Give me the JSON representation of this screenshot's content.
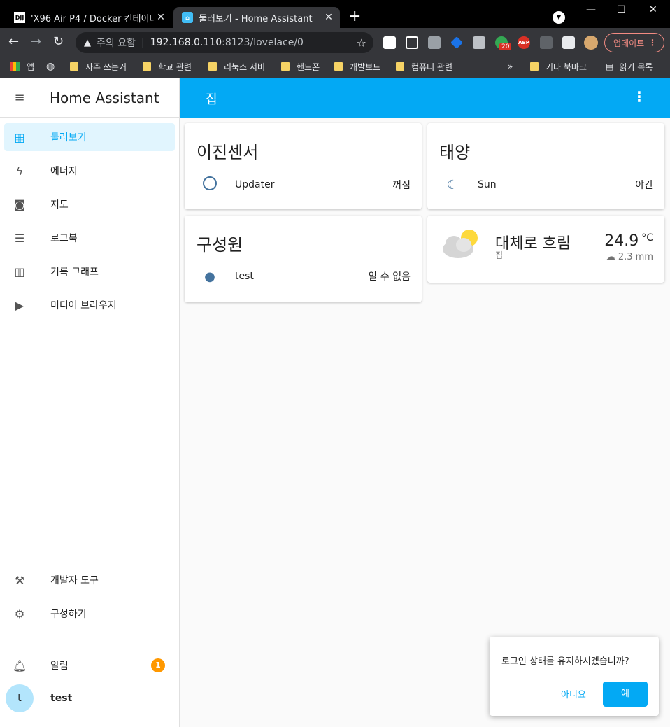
{
  "browser": {
    "tabs": [
      {
        "title": "'X96 Air P4 / Docker 컨테이너 L",
        "favicon_text": "DJJ",
        "active": false
      },
      {
        "title": "둘러보기 - Home Assistant",
        "active": true
      }
    ],
    "url": {
      "warning": "주의 요함",
      "host": "192.168.0.110",
      "path": ":8123/lovelace/0"
    },
    "extension_badge": "20",
    "abp_label": "ABP",
    "update_label": "업데이트",
    "bookmarks": [
      "앱",
      "자주 쓰는거",
      "학교 관련",
      "리눅스 서버",
      "핸드폰",
      "개발보드",
      "컴퓨터 관련"
    ],
    "bookmarks_right": [
      "기타 북마크",
      "읽기 목록"
    ]
  },
  "sidebar": {
    "title": "Home Assistant",
    "items": [
      {
        "label": "둘러보기",
        "icon": "dashboard-icon"
      },
      {
        "label": "에너지",
        "icon": "lightning-icon"
      },
      {
        "label": "지도",
        "icon": "map-icon"
      },
      {
        "label": "로그북",
        "icon": "logbook-icon"
      },
      {
        "label": "기록 그래프",
        "icon": "chart-icon"
      },
      {
        "label": "미디어 브라우저",
        "icon": "media-icon"
      }
    ],
    "bottom_items": [
      {
        "label": "개발자 도구",
        "icon": "hammer-icon"
      },
      {
        "label": "구성하기",
        "icon": "gear-icon"
      }
    ],
    "notifications": {
      "label": "알림",
      "count": "1"
    },
    "user": {
      "initial": "t",
      "name": "test"
    }
  },
  "header": {
    "view": "집"
  },
  "cards": {
    "binary": {
      "title": "이진센서",
      "entity": "Updater",
      "state": "꺼짐"
    },
    "sun": {
      "title": "태양",
      "entity": "Sun",
      "state": "야간"
    },
    "person": {
      "title": "구성원",
      "entity": "test",
      "state": "알 수 없음"
    },
    "weather": {
      "condition": "대체로 흐림",
      "name": "집",
      "temperature": "24.9",
      "unit": "°C",
      "precipitation": "2.3 mm"
    }
  },
  "toast": {
    "message": "로그인 상태를 유지하시겠습니까?",
    "no": "아니요",
    "yes": "예"
  },
  "colors": {
    "primary": "#03a9f4",
    "icon": "#44739e",
    "badge": "#ff9800"
  }
}
